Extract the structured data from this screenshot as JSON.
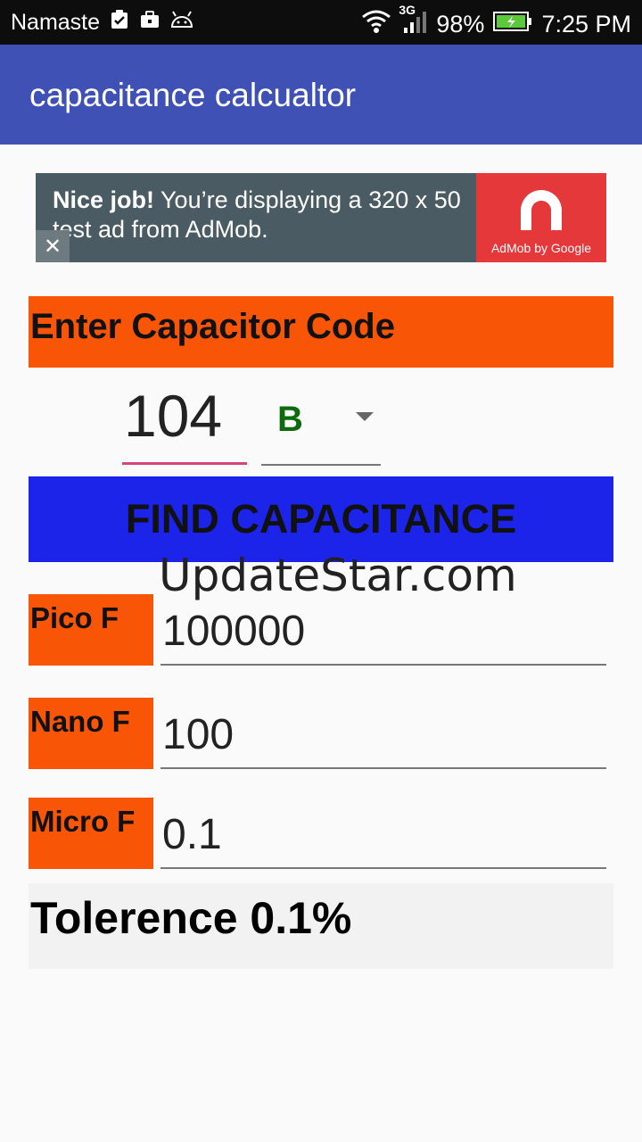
{
  "status_bar": {
    "carrier": "Namaste",
    "network": "3G",
    "battery": "98%",
    "time": "7:25 PM",
    "icons": [
      "clipboard-check-icon",
      "briefcase-icon",
      "android-icon",
      "wifi-icon",
      "signal-icon",
      "battery-charging-icon"
    ]
  },
  "app_bar": {
    "title": "capacitance calcualtor",
    "color": "#3f51b5"
  },
  "ad": {
    "bold": "Nice job!",
    "text": " You’re displaying a 320 x 50 test ad from AdMob.",
    "close": "✕",
    "logo_caption": "AdMob by Google"
  },
  "code_section": {
    "header": "Enter Capacitor Code",
    "code_value": "104",
    "tolerance_selected": "B"
  },
  "find_button": {
    "label": "FIND CAPACITANCE",
    "color": "#1b24e8"
  },
  "watermark": "UpdateStar.com",
  "results": {
    "pico_label": "Pico F",
    "pico_value": "100000",
    "nano_label": "Nano F",
    "nano_value": "100",
    "micro_label": "Micro F",
    "micro_value": "0.1"
  },
  "tolerance_result": "Tolerence 0.1%",
  "colors": {
    "accent_orange": "#f85606",
    "input_underline": "#d8437a",
    "tolerance_text": "#0d6b0d"
  }
}
